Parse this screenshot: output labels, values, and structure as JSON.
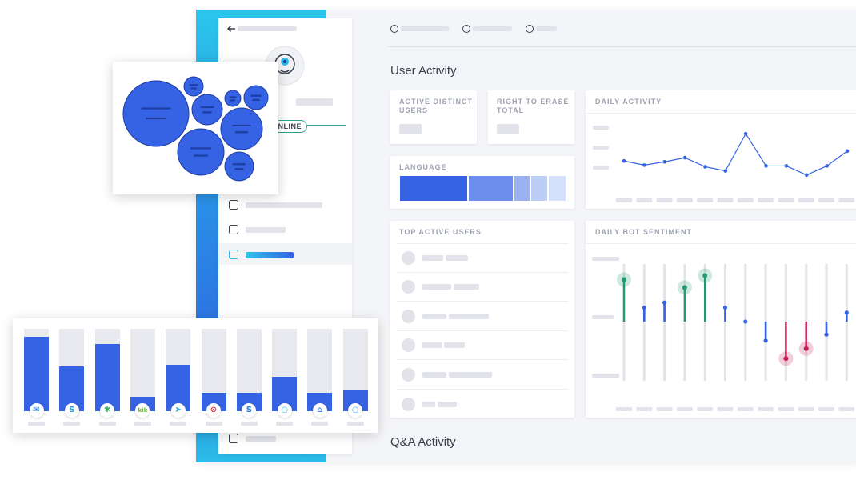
{
  "sidebar": {
    "status_badge": "ONLINE"
  },
  "filters": {
    "count": 3
  },
  "sections": {
    "user_activity": "User Activity",
    "qa_activity": "Q&A Activity"
  },
  "cards": {
    "active_distinct_users": "ACTIVE DISTINCT\nUSERS",
    "right_to_erase_total": "RIGHT TO ERASE\nTOTAL",
    "language": "LANGUAGE",
    "daily_activity": "DAILY ACTIVITY",
    "top_active_users": "TOP ACTIVE USERS",
    "daily_bot_sentiment": "DAILY BOT SENTIMENT"
  },
  "colors": {
    "primary_blue": "#3563e4",
    "positive_green": "#219a6e",
    "negative_red": "#c61f56",
    "accent_cyan": "#2bc6ea"
  },
  "language_bar": {
    "segments": [
      0.36,
      0.24,
      0.09,
      0.09,
      0.09
    ],
    "colors": [
      "#3563e4",
      "#6d8fec",
      "#9ab2f2",
      "#bccdf6",
      "#d5e0fa"
    ]
  },
  "daily_activity": {
    "type": "line",
    "y": [
      2.3,
      1.8,
      2.2,
      2.7,
      1.6,
      1.1,
      5.6,
      1.7,
      1.7,
      0.6,
      1.7,
      3.5
    ]
  },
  "daily_bot_sentiment": {
    "type": "lollipop",
    "y": [
      4.2,
      1.4,
      1.9,
      3.4,
      4.6,
      1.4,
      0.0,
      -1.9,
      -3.7,
      -2.7,
      -1.3,
      0.9,
      2.2
    ]
  },
  "bubble_chart": {
    "type": "bubble",
    "sizes": [
      41,
      12,
      19,
      26,
      29,
      10,
      15,
      18
    ]
  },
  "channel_bars": {
    "type": "bar",
    "values": [
      0.9,
      0.54,
      0.82,
      0.17,
      0.56,
      0.22,
      0.22,
      0.42,
      0.22,
      0.25
    ],
    "icons": [
      "messenger-icon",
      "skype-icon",
      "slack-icon",
      "kik-icon",
      "telegram-icon",
      "twilio-icon",
      "skype-business-icon",
      "alexa-icon",
      "google-home-icon",
      "cortana-icon"
    ],
    "icon_glyphs": [
      "✉",
      "S",
      "✱",
      "kik",
      "➤",
      "⊙",
      "S",
      "○",
      "⌂",
      "○"
    ],
    "icon_colors": [
      "#1e7ee8",
      "#1ea6e8",
      "#3aa95b",
      "#68b334",
      "#2a9fd8",
      "#e2213a",
      "#1e7ee8",
      "#2bb6e6",
      "#4285f4",
      "#2aa8e6"
    ]
  }
}
